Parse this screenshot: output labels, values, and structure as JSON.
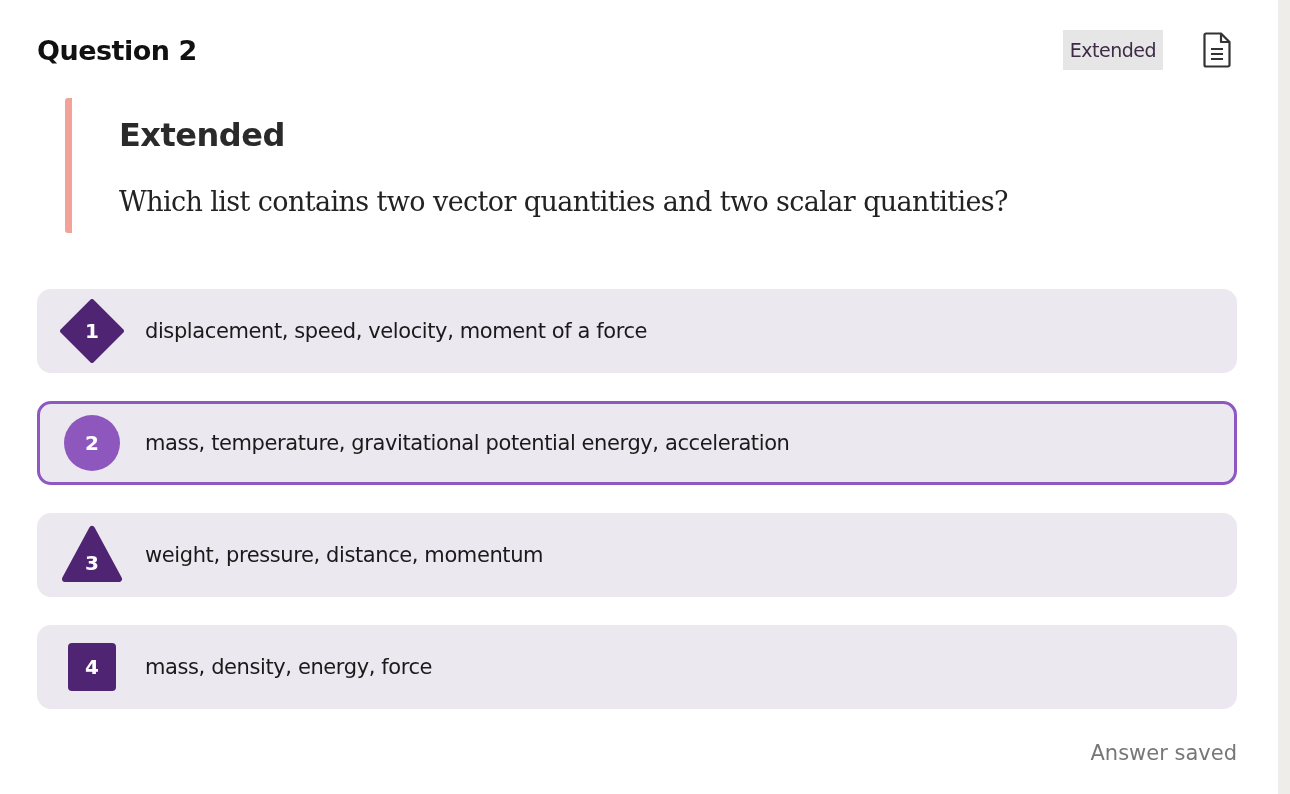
{
  "question": {
    "title": "Question 2",
    "tag": "Extended"
  },
  "prompt": {
    "heading": "Extended",
    "text": "Which list contains two vector quantities and two scalar quantities?"
  },
  "options": [
    {
      "number": "1",
      "kind": "diamond",
      "text": "displacement, speed, velocity, moment of a force",
      "selected": false
    },
    {
      "number": "2",
      "kind": "circle",
      "text": "mass, temperature, gravitational potential energy, acceleration",
      "selected": true
    },
    {
      "number": "3",
      "kind": "triangle",
      "text": "weight, pressure, distance, momentum",
      "selected": false
    },
    {
      "number": "4",
      "kind": "square",
      "text": "mass, density, energy, force",
      "selected": false
    }
  ],
  "status": "Answer saved"
}
